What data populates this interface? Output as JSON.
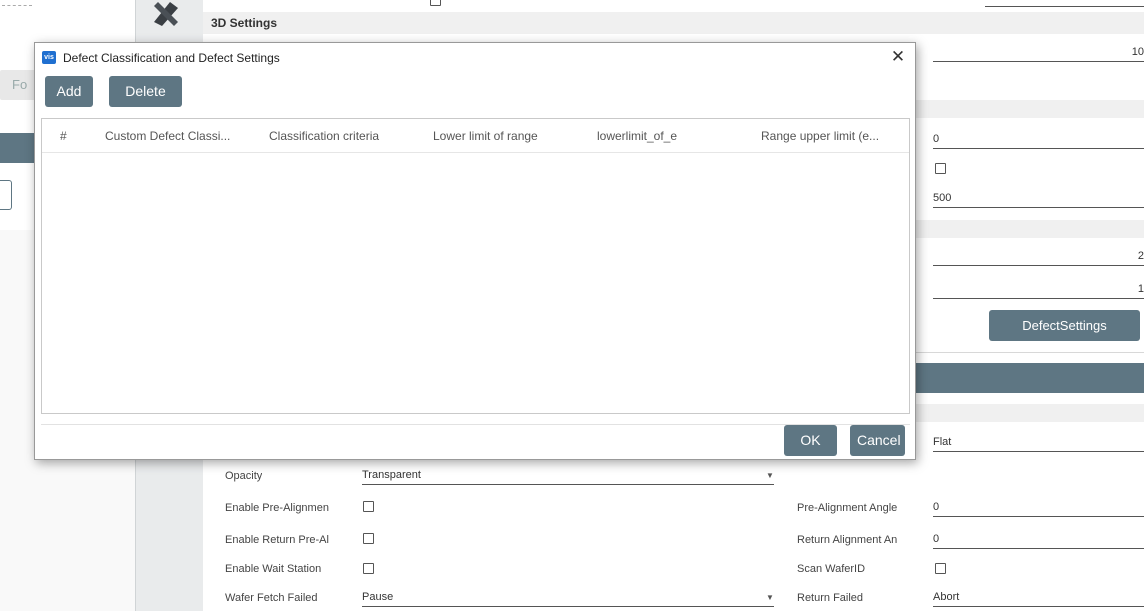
{
  "background": {
    "left_button": "Fo",
    "section_3d": "3D Settings",
    "fields_right": {
      "top_value": "10",
      "f1": "0",
      "f2": "500",
      "f3": "2",
      "f4": "1",
      "shape": "Flat"
    },
    "defect_settings_button": "DefectSettings",
    "form": {
      "opacity_label": "Opacity",
      "opacity_value": "Transparent",
      "pre_align_label": "Enable Pre-Alignmen",
      "return_pre_label": "Enable Return Pre-Al",
      "wait_station_label": "Enable Wait Station",
      "fetch_failed_label": "Wafer Fetch Failed",
      "fetch_failed_value": "Pause",
      "pre_align_angle_label": "Pre-Alignment Angle",
      "pre_align_angle_value": "0",
      "return_align_label": "Return Alignment An",
      "return_align_value": "0",
      "scan_waferid_label": "Scan WaferID",
      "return_failed_label": "Return Failed",
      "return_failed_value": "Abort"
    }
  },
  "dialog": {
    "app_icon": "vis",
    "title": "Defect Classification and Defect Settings",
    "close_glyph": "✕",
    "add_label": "Add",
    "delete_label": "Delete",
    "columns": [
      "#",
      "Custom Defect Classi...",
      "Classification criteria",
      "Lower limit of range",
      "lowerlimit_of_e",
      "Range upper limit (e..."
    ],
    "ok_label": "OK",
    "cancel_label": "Cancel"
  },
  "colors": {
    "accent": "#5e7683",
    "section_bg": "#f0f0f0"
  }
}
